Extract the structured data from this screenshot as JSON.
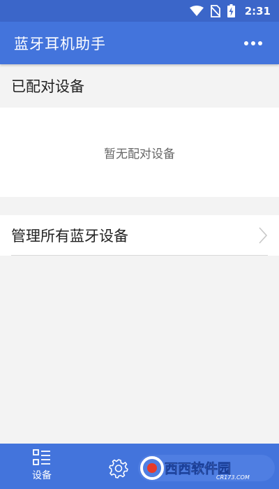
{
  "status_bar": {
    "time": "2:31",
    "icons": [
      "wifi-icon",
      "no-sim-icon",
      "battery-charging-icon"
    ]
  },
  "app_bar": {
    "title": "蓝牙耳机助手",
    "menu_icon": "more-horizontal-icon"
  },
  "paired_section": {
    "title": "已配对设备",
    "empty_text": "暂无配对设备"
  },
  "manage_row": {
    "label": "管理所有蓝牙设备",
    "icon": "chevron-right-icon"
  },
  "bottom_nav": {
    "items": [
      {
        "label": "设备",
        "icon": "device-list-icon"
      },
      {
        "label": "",
        "icon": "settings-icon"
      }
    ],
    "watermark_text": "西西软件园",
    "watermark_subtext": "CR173.COM"
  },
  "colors": {
    "primary": "#4374dc",
    "status_bar": "#3b66c9",
    "background": "#f3f3f3"
  }
}
